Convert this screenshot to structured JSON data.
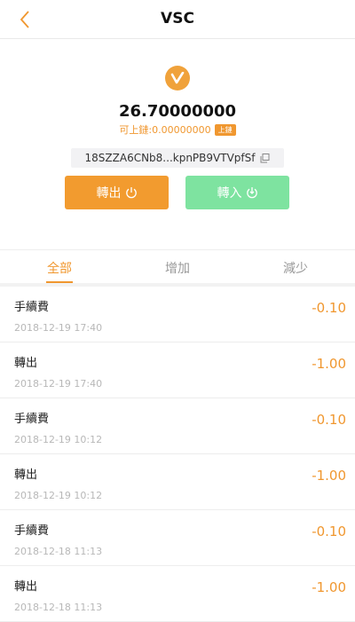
{
  "header": {
    "title": "VSC",
    "back_icon": "chevron-left-icon"
  },
  "asset": {
    "icon": "v-coin-icon",
    "balance": "26.70000000",
    "on_chain_label": "可上鏈:0.00000000",
    "on_chain_badge": "上鏈",
    "address": "18SZZA6CNb8...kpnPB9VTVpfSf"
  },
  "actions": {
    "transfer_out": "轉出",
    "transfer_in": "轉入"
  },
  "tabs": [
    {
      "label": "全部",
      "active": true
    },
    {
      "label": "增加",
      "active": false
    },
    {
      "label": "減少",
      "active": false
    }
  ],
  "transactions": [
    {
      "title": "手續費",
      "time": "2018-12-19 17:40",
      "amount": "-0.10"
    },
    {
      "title": "轉出",
      "time": "2018-12-19 17:40",
      "amount": "-1.00"
    },
    {
      "title": "手續費",
      "time": "2018-12-19 10:12",
      "amount": "-0.10"
    },
    {
      "title": "轉出",
      "time": "2018-12-19 10:12",
      "amount": "-1.00"
    },
    {
      "title": "手續費",
      "time": "2018-12-18 11:13",
      "amount": "-0.10"
    },
    {
      "title": "轉出",
      "time": "2018-12-18 11:13",
      "amount": "-1.00"
    }
  ],
  "colors": {
    "accent": "#f0972f",
    "transfer_in": "#7ee3a0"
  }
}
